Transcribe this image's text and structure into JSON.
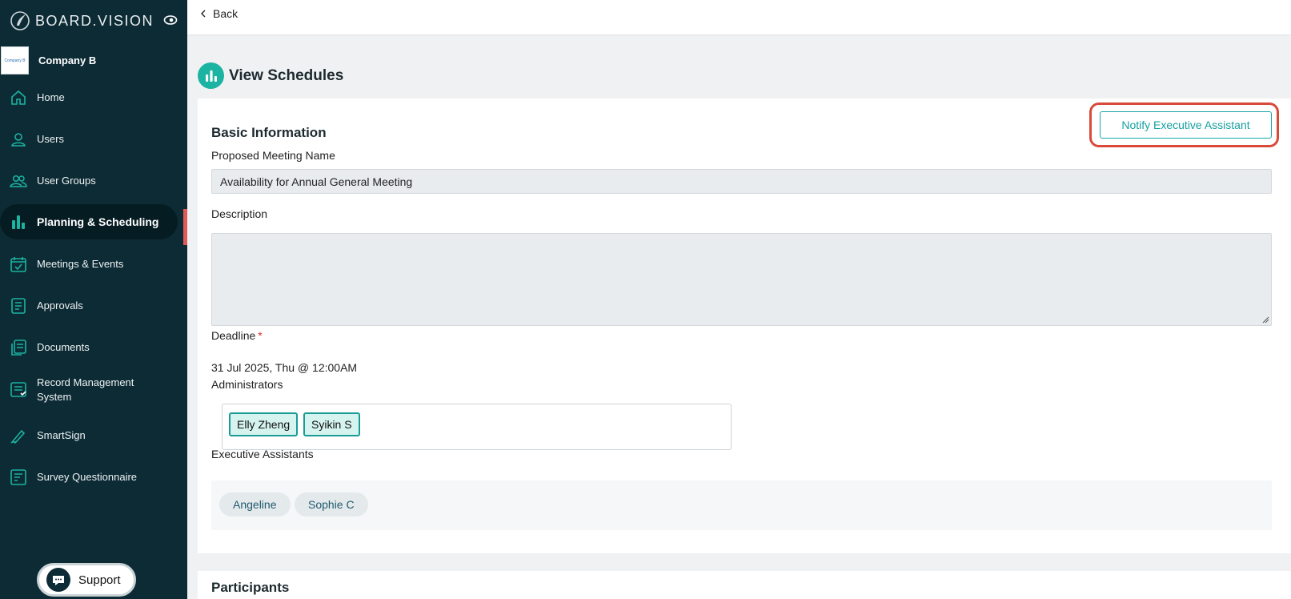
{
  "brand": {
    "name": "BOARD.VISION"
  },
  "company": {
    "name": "Company B",
    "logo_text": "Company B"
  },
  "sidebar": {
    "items": [
      {
        "label": "Home",
        "icon": "home-icon"
      },
      {
        "label": "Users",
        "icon": "user-icon"
      },
      {
        "label": "User Groups",
        "icon": "user-group-icon"
      },
      {
        "label": "Planning & Scheduling",
        "icon": "bar-chart-icon",
        "active": true
      },
      {
        "label": "Meetings & Events",
        "icon": "calendar-check-icon"
      },
      {
        "label": "Approvals",
        "icon": "document-lines-icon"
      },
      {
        "label": "Documents",
        "icon": "documents-icon"
      },
      {
        "label": "Record Management System",
        "icon": "record-icon"
      },
      {
        "label": "SmartSign",
        "icon": "pen-icon"
      },
      {
        "label": "Survey Questionnaire",
        "icon": "survey-icon"
      }
    ],
    "support_label": "Support"
  },
  "topbar": {
    "back_label": "Back"
  },
  "page": {
    "title": "View Schedules",
    "section_title": "Basic Information",
    "notify_button": "Notify Executive Assistant",
    "fields": {
      "meeting_name_label": "Proposed Meeting Name",
      "meeting_name_value": "Availability for Annual General Meeting",
      "description_label": "Description",
      "description_value": "",
      "deadline_label": "Deadline",
      "deadline_required": "*",
      "deadline_value": "31 Jul 2025, Thu @ 12:00AM",
      "administrators_label": "Administrators",
      "administrators": [
        "Elly Zheng",
        "Syikin S"
      ],
      "executive_assistants_label": "Executive Assistants",
      "executive_assistants": [
        "Angeline",
        "Sophie C"
      ]
    },
    "participants_title": "Participants"
  },
  "colors": {
    "sidebar_bg": "#0d2b35",
    "accent_teal": "#1bb3a1",
    "highlight_red": "#d84a3a",
    "active_indicator": "#e05a5a"
  }
}
